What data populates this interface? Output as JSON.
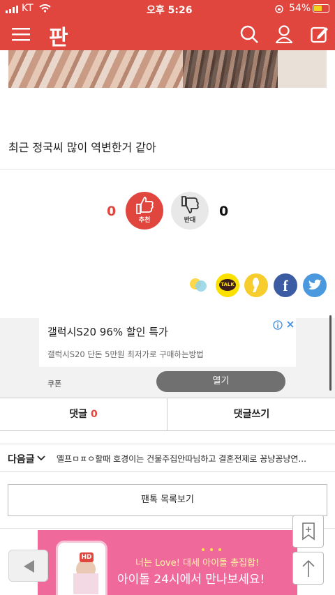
{
  "status_bar": {
    "carrier": "KT",
    "time": "오후 5:26",
    "battery": "54%"
  },
  "navbar": {
    "logo": "판",
    "icons": [
      "menu-icon",
      "search-icon",
      "user-icon",
      "edit-icon"
    ],
    "color": "#e0463e"
  },
  "post": {
    "text": "최근 정국씨 많이 역변한거 같아"
  },
  "vote": {
    "up_count": "0",
    "up_label": "추천",
    "up_color": "#e0463e",
    "down_count": "0",
    "down_label": "반대"
  },
  "share": [
    "kakaostory-icon",
    "kakaotalk-icon",
    "kakaopage-icon",
    "facebook-icon",
    "twitter-icon"
  ],
  "ad": {
    "title": "갤럭시S20 96% 할인 특가",
    "description": "갤럭시S20 단돈 5만원 최저가로 구매하는방법",
    "brand": "쿠폰",
    "open_label": "열기"
  },
  "tabs": {
    "comments_label": "댓글",
    "comments_count": "0",
    "write_label": "댓글쓰기"
  },
  "next_post": {
    "label": "다음글",
    "title": "옐프ㅁㅍㅇ할때 호경이는 건물주집안따님하고 결혼전제로 꽁냥꽁냥연..."
  },
  "list_button": {
    "label": "팬톡 목록보기"
  },
  "bottom_ad": {
    "line1": "너는 Love! 대세 아이돌 총집합!",
    "line2": "아이돌 24시에서 만나보세요!",
    "badge": "HD",
    "color": "#ef6a9b"
  }
}
